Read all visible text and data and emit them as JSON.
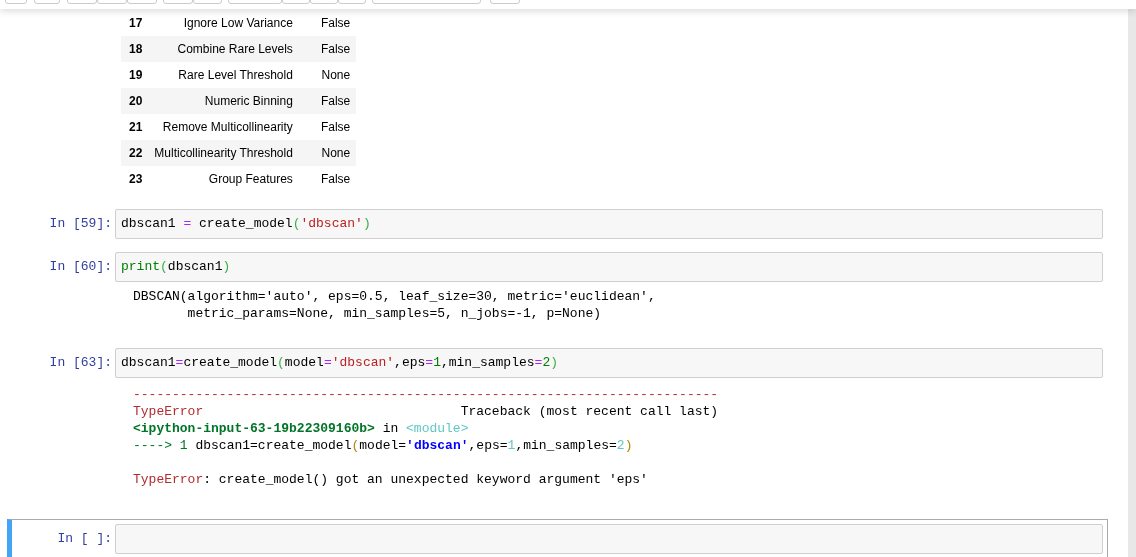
{
  "table": {
    "rows": [
      {
        "index": "17",
        "name": "Ignore Low Variance",
        "value": "False"
      },
      {
        "index": "18",
        "name": "Combine Rare Levels",
        "value": "False"
      },
      {
        "index": "19",
        "name": "Rare Level Threshold",
        "value": "None"
      },
      {
        "index": "20",
        "name": "Numeric Binning",
        "value": "False"
      },
      {
        "index": "21",
        "name": "Remove Multicollinearity",
        "value": "False"
      },
      {
        "index": "22",
        "name": "Multicollinearity Threshold",
        "value": "None"
      },
      {
        "index": "23",
        "name": "Group Features",
        "value": "False"
      }
    ]
  },
  "cells": [
    {
      "prompt": "In [59]:",
      "selected": false,
      "code": [
        {
          "text": "dbscan1 ",
          "kind": "plain"
        },
        {
          "text": "=",
          "kind": "operator"
        },
        {
          "text": " create_model",
          "kind": "plain"
        },
        {
          "text": "(",
          "kind": "paren"
        },
        {
          "text": "'dbscan'",
          "kind": "string"
        },
        {
          "text": ")",
          "kind": "paren"
        }
      ]
    },
    {
      "prompt": "In [60]:",
      "selected": false,
      "code": [
        {
          "text": "print",
          "kind": "builtin"
        },
        {
          "text": "(",
          "kind": "paren"
        },
        {
          "text": "dbscan1",
          "kind": "plain"
        },
        {
          "text": ")",
          "kind": "paren"
        }
      ],
      "output": {
        "kind": "stdout",
        "lines": [
          "DBSCAN(algorithm='auto', eps=0.5, leaf_size=30, metric='euclidean',",
          "       metric_params=None, min_samples=5, n_jobs=-1, p=None)"
        ]
      }
    },
    {
      "prompt": "In [63]:",
      "selected": false,
      "code": [
        {
          "text": "dbscan1",
          "kind": "plain"
        },
        {
          "text": "=",
          "kind": "operator"
        },
        {
          "text": "create_model",
          "kind": "plain"
        },
        {
          "text": "(",
          "kind": "paren"
        },
        {
          "text": "model",
          "kind": "plain"
        },
        {
          "text": "=",
          "kind": "operator"
        },
        {
          "text": "'dbscan'",
          "kind": "string"
        },
        {
          "text": ",eps",
          "kind": "plain"
        },
        {
          "text": "=",
          "kind": "operator"
        },
        {
          "text": "1",
          "kind": "number"
        },
        {
          "text": ",min_samples",
          "kind": "plain"
        },
        {
          "text": "=",
          "kind": "operator"
        },
        {
          "text": "2",
          "kind": "number"
        },
        {
          "text": ")",
          "kind": "paren"
        }
      ],
      "output": {
        "kind": "error",
        "lines": [
          [
            {
              "text": "---------------------------------------------------------------------------",
              "kind": "err_red"
            }
          ],
          [
            {
              "text": "TypeError",
              "kind": "err_red"
            },
            {
              "text": "                                 Traceback (most recent call last)",
              "kind": "plain"
            }
          ],
          [
            {
              "text": "<ipython-input-63-19b22309160b>",
              "kind": "tb_file"
            },
            {
              "text": " in ",
              "kind": "plain"
            },
            {
              "text": "<module>",
              "kind": "tb_cyan"
            }
          ],
          [
            {
              "text": "----> 1 ",
              "kind": "tb_green"
            },
            {
              "text": "dbscan1",
              "kind": "plain"
            },
            {
              "text": "=",
              "kind": "plain"
            },
            {
              "text": "create_model",
              "kind": "plain"
            },
            {
              "text": "(",
              "kind": "tb_paren"
            },
            {
              "text": "model",
              "kind": "plain"
            },
            {
              "text": "=",
              "kind": "plain"
            },
            {
              "text": "'dbscan'",
              "kind": "tb_string"
            },
            {
              "text": ",eps",
              "kind": "plain"
            },
            {
              "text": "=",
              "kind": "plain"
            },
            {
              "text": "1",
              "kind": "tb_cyan"
            },
            {
              "text": ",min_samples",
              "kind": "plain"
            },
            {
              "text": "=",
              "kind": "plain"
            },
            {
              "text": "2",
              "kind": "tb_cyan"
            },
            {
              "text": ")",
              "kind": "tb_paren"
            }
          ],
          {
            "kind": "blank"
          },
          [
            {
              "text": "TypeError",
              "kind": "err_red"
            },
            {
              "text": ": create_model() got an unexpected keyword argument 'eps'",
              "kind": "plain"
            }
          ]
        ]
      }
    },
    {
      "prompt": "In [ ]:",
      "selected": true
    }
  ]
}
